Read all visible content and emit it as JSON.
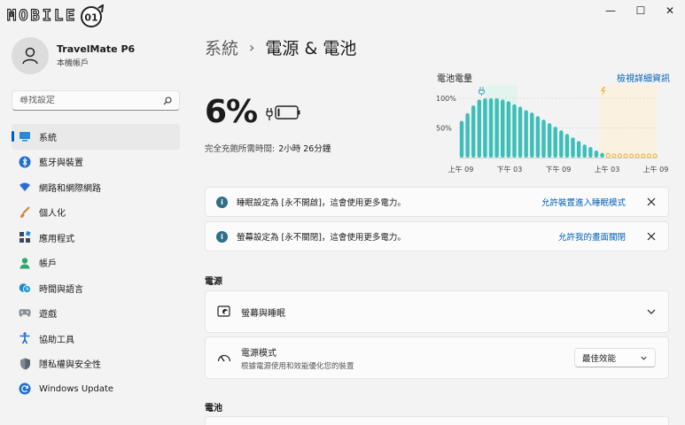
{
  "branding": {
    "logo_text": "MOBILE",
    "logo_badge": "01"
  },
  "window": {
    "minimize": "—",
    "maximize": "☐",
    "close": "✕"
  },
  "profile": {
    "name": "TravelMate P6",
    "subtitle": "本機帳戶"
  },
  "search": {
    "placeholder": "尋找設定"
  },
  "sidebar": {
    "items": [
      {
        "label": "系統",
        "icon": "monitor-icon",
        "active": true
      },
      {
        "label": "藍牙與裝置",
        "icon": "bluetooth-icon"
      },
      {
        "label": "網路和網際網路",
        "icon": "wifi-icon"
      },
      {
        "label": "個人化",
        "icon": "brush-icon"
      },
      {
        "label": "應用程式",
        "icon": "apps-icon"
      },
      {
        "label": "帳戶",
        "icon": "person-icon"
      },
      {
        "label": "時間與語言",
        "icon": "clock-globe-icon"
      },
      {
        "label": "遊戲",
        "icon": "gamepad-icon"
      },
      {
        "label": "協助工具",
        "icon": "accessibility-icon"
      },
      {
        "label": "隱私權與安全性",
        "icon": "shield-icon"
      },
      {
        "label": "Windows Update",
        "icon": "update-icon"
      }
    ]
  },
  "breadcrumb": {
    "parent": "系統",
    "separator": "›",
    "current": "電源 & 電池"
  },
  "battery": {
    "percent": "6%",
    "charge_label": "完全充飽所需時間:",
    "charge_time": "2小時 26分鐘"
  },
  "chart_data": {
    "type": "bar",
    "title": "電池電量",
    "link": "檢視詳細資訊",
    "y_ticks": [
      "100%",
      "50%"
    ],
    "x_ticks": [
      "上午 09",
      "下午 03",
      "下午 09",
      "上午 03",
      "上午 09"
    ],
    "ylim": [
      0,
      100
    ],
    "values": [
      62,
      75,
      88,
      98,
      100,
      100,
      100,
      98,
      95,
      90,
      86,
      80,
      76,
      70,
      64,
      58,
      52,
      46,
      40,
      34,
      28,
      22,
      18,
      12,
      8,
      7,
      6,
      6,
      6,
      6,
      6,
      6,
      6,
      6
    ],
    "low_start_index": 25,
    "colors": {
      "normal": "#3bbfb8",
      "low": "#e8b54a"
    }
  },
  "notices": [
    {
      "text": "睡眠設定為 [永不開啟]，這會使用更多電力。",
      "link": "允許裝置進入睡眠模式"
    },
    {
      "text": "螢幕設定為 [永不關閉]，這會使用更多電力。",
      "link": "允許我的畫面關閉"
    }
  ],
  "power_section": {
    "heading": "電源",
    "screen_sleep": {
      "title": "螢幕與睡眠"
    },
    "power_mode": {
      "title": "電源模式",
      "description": "根據電源使用和效能優化您的裝置",
      "value": "最佳效能"
    }
  },
  "battery_section": {
    "heading": "電池"
  },
  "colors": {
    "accent": "#005fb8"
  }
}
